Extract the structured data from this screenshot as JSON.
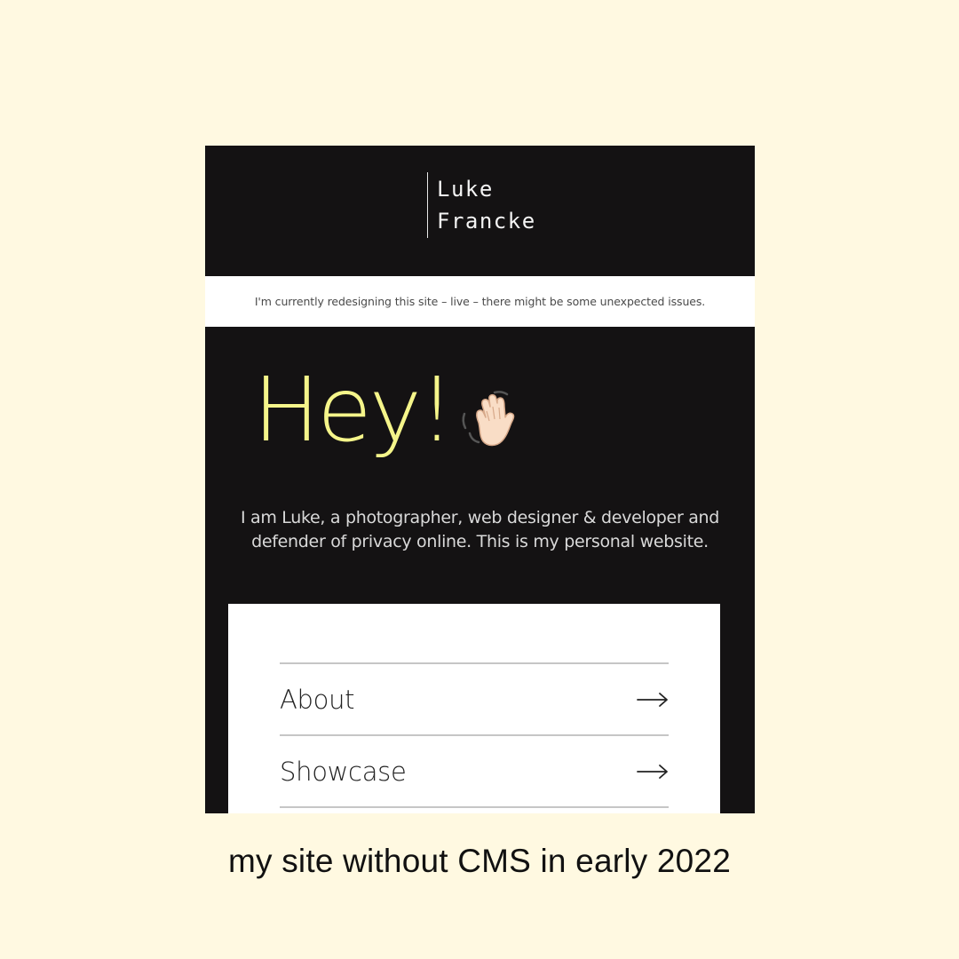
{
  "site": {
    "logo_first": "Luke",
    "logo_last": "Francke"
  },
  "notice": {
    "text": "I'm currently redesigning this site – live – there might be some unexpected issues."
  },
  "hero": {
    "heading": "Hey!",
    "emoji_icon": "waving-hand-icon",
    "intro_line1": "I am Luke, a photographer, web designer & developer and",
    "intro_line2": "defender of privacy online. This is my personal website."
  },
  "nav": {
    "items": [
      {
        "label": "About",
        "icon": "arrow-right-icon"
      },
      {
        "label": "Showcase",
        "icon": "arrow-right-icon"
      }
    ]
  },
  "caption": {
    "text": "my site without CMS in early 2022"
  },
  "colors": {
    "page_background": "#FFF9E1",
    "site_background": "#141213",
    "accent_yellow": "#F5F58A"
  }
}
